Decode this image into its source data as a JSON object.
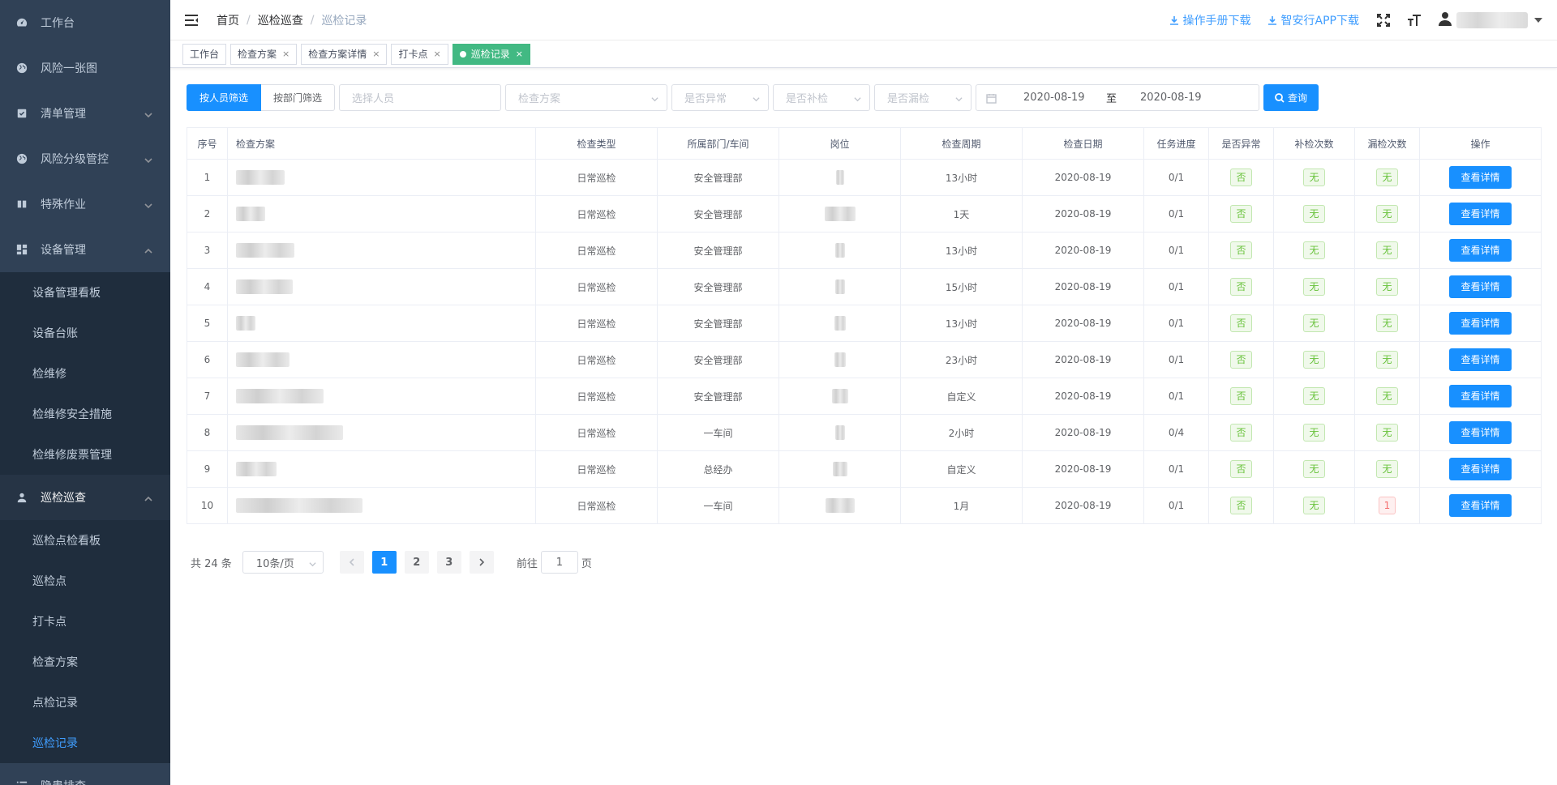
{
  "sidebar": {
    "items": [
      {
        "label": "工作台",
        "icon": "dashboard-icon",
        "has_children": false
      },
      {
        "label": "风险一张图",
        "icon": "globe-icon",
        "has_children": false
      },
      {
        "label": "清单管理",
        "icon": "checklist-icon",
        "has_children": true
      },
      {
        "label": "风险分级管控",
        "icon": "globe-icon",
        "has_children": true
      },
      {
        "label": "特殊作业",
        "icon": "book-icon",
        "has_children": true
      },
      {
        "label": "设备管理",
        "icon": "grid-icon",
        "has_children": true,
        "expanded": true
      }
    ],
    "device_sub": [
      "设备管理看板",
      "设备台账",
      "检维修",
      "检维修安全措施",
      "检维修废票管理"
    ],
    "patrol": {
      "label": "巡检巡查",
      "icon": "inspector-icon",
      "expanded": true
    },
    "patrol_sub": [
      "巡检点检看板",
      "巡检点",
      "打卡点",
      "检查方案",
      "点检记录",
      "巡检记录"
    ],
    "active_sub": "巡检记录",
    "next_item": {
      "label": "隐患排查",
      "icon": "list-icon"
    }
  },
  "navbar": {
    "breadcrumb": [
      "首页",
      "巡检巡查",
      "巡检记录"
    ],
    "manual_download": "操作手册下载",
    "app_download": "智安行APP下载"
  },
  "tags": [
    {
      "label": "工作台",
      "closable": false,
      "active": false
    },
    {
      "label": "检查方案",
      "closable": true,
      "active": false
    },
    {
      "label": "检查方案详情",
      "closable": true,
      "active": false
    },
    {
      "label": "打卡点",
      "closable": true,
      "active": false
    },
    {
      "label": "巡检记录",
      "closable": true,
      "active": true
    }
  ],
  "filters": {
    "by_person": "按人员筛选",
    "by_dept": "按部门筛选",
    "person_placeholder": "选择人员",
    "plan_placeholder": "检查方案",
    "abnormal_placeholder": "是否异常",
    "recheck_placeholder": "是否补检",
    "missed_placeholder": "是否漏检",
    "date_start": "2020-08-19",
    "date_sep": "至",
    "date_end": "2020-08-19",
    "search": "查询"
  },
  "table": {
    "columns": [
      "序号",
      "检查方案",
      "检查类型",
      "所属部门/车间",
      "岗位",
      "检查周期",
      "检查日期",
      "任务进度",
      "是否异常",
      "补检次数",
      "漏检次数",
      "操作"
    ],
    "detail_label": "查看详情",
    "rows": [
      {
        "no": "1",
        "type": "日常巡检",
        "dept": "安全管理部",
        "cycle": "13小时",
        "date": "2020-08-19",
        "progress": "0/1",
        "abnormal": "否",
        "recheck": "无",
        "missed": "无"
      },
      {
        "no": "2",
        "type": "日常巡检",
        "dept": "安全管理部",
        "cycle": "1天",
        "date": "2020-08-19",
        "progress": "0/1",
        "abnormal": "否",
        "recheck": "无",
        "missed": "无"
      },
      {
        "no": "3",
        "type": "日常巡检",
        "dept": "安全管理部",
        "cycle": "13小时",
        "date": "2020-08-19",
        "progress": "0/1",
        "abnormal": "否",
        "recheck": "无",
        "missed": "无"
      },
      {
        "no": "4",
        "type": "日常巡检",
        "dept": "安全管理部",
        "cycle": "15小时",
        "date": "2020-08-19",
        "progress": "0/1",
        "abnormal": "否",
        "recheck": "无",
        "missed": "无"
      },
      {
        "no": "5",
        "type": "日常巡检",
        "dept": "安全管理部",
        "cycle": "13小时",
        "date": "2020-08-19",
        "progress": "0/1",
        "abnormal": "否",
        "recheck": "无",
        "missed": "无"
      },
      {
        "no": "6",
        "type": "日常巡检",
        "dept": "安全管理部",
        "cycle": "23小时",
        "date": "2020-08-19",
        "progress": "0/1",
        "abnormal": "否",
        "recheck": "无",
        "missed": "无"
      },
      {
        "no": "7",
        "type": "日常巡检",
        "dept": "安全管理部",
        "cycle": "自定义",
        "date": "2020-08-19",
        "progress": "0/1",
        "abnormal": "否",
        "recheck": "无",
        "missed": "无"
      },
      {
        "no": "8",
        "type": "日常巡检",
        "dept": "一车间",
        "cycle": "2小时",
        "date": "2020-08-19",
        "progress": "0/4",
        "abnormal": "否",
        "recheck": "无",
        "missed": "无"
      },
      {
        "no": "9",
        "type": "日常巡检",
        "dept": "总经办",
        "cycle": "自定义",
        "date": "2020-08-19",
        "progress": "0/1",
        "abnormal": "否",
        "recheck": "无",
        "missed": "无"
      },
      {
        "no": "10",
        "type": "日常巡检",
        "dept": "一车间",
        "cycle": "1月",
        "date": "2020-08-19",
        "progress": "0/1",
        "abnormal": "否",
        "recheck": "无",
        "missed": "1"
      }
    ]
  },
  "pagination": {
    "total_text": "共 24 条",
    "page_size": "10条/页",
    "pages": [
      "1",
      "2",
      "3"
    ],
    "current": "1",
    "goto_prefix": "前往",
    "goto_value": "1",
    "goto_suffix": "页"
  },
  "colors": {
    "sidebar_bg": "#304156",
    "submenu_bg": "#1f2d3d",
    "primary": "#1890ff",
    "active_tag": "#42b983"
  }
}
